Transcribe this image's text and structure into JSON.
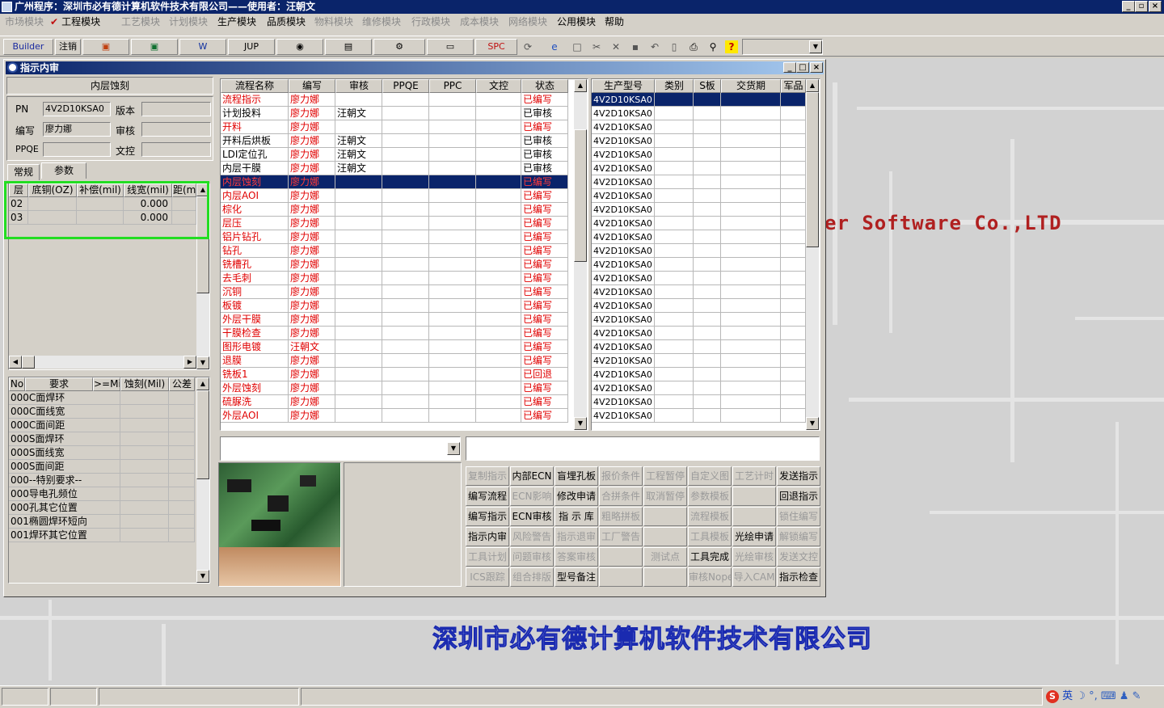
{
  "app": {
    "title": "广州程序：深圳市必有德计算机软件技术有限公司——使用者：汪朝文"
  },
  "menu": [
    {
      "label": "市场模块",
      "enabled": false
    },
    {
      "label": "工程模块",
      "enabled": true,
      "checked": true
    },
    {
      "label": "工艺模块",
      "enabled": false
    },
    {
      "label": "计划模块",
      "enabled": false
    },
    {
      "label": "生产模块",
      "enabled": true
    },
    {
      "label": "品质模块",
      "enabled": true
    },
    {
      "label": "物料模块",
      "enabled": false
    },
    {
      "label": "维修模块",
      "enabled": false
    },
    {
      "label": "行政模块",
      "enabled": false
    },
    {
      "label": "成本模块",
      "enabled": false
    },
    {
      "label": "网络模块",
      "enabled": false
    },
    {
      "label": "公用模块",
      "enabled": true
    },
    {
      "label": "帮助",
      "enabled": true
    }
  ],
  "toolbar": {
    "builder": "Builder",
    "logout": "注销",
    "jup": "JUP",
    "spc": "SPC"
  },
  "window": {
    "title": "指示内审"
  },
  "left_panel": {
    "process_title": "内层蚀刻",
    "pn_label": "PN",
    "pn_value": "4V2D10KSA0",
    "version_label": "版本",
    "version_value": "",
    "writer_label": "编写",
    "writer_value": "廖力娜",
    "review_label": "审核",
    "review_value": "",
    "ppqe_label": "PPQE",
    "ppqe_value": "",
    "doc_label": "文控",
    "doc_value": "",
    "tabs": [
      "常规",
      "参数"
    ],
    "param_headers": [
      "层",
      "底铜(OZ)",
      "补偿(mil)",
      "线宽(mil)",
      "距(mi"
    ],
    "param_rows": [
      [
        "02",
        "",
        "",
        "0.000",
        ""
      ],
      [
        "03",
        "",
        "",
        "0.000",
        ""
      ]
    ],
    "req_headers": [
      "No",
      "要求",
      ">=Mil",
      "蚀刻(Mil)",
      "公差"
    ],
    "req_rows": [
      [
        "000",
        "C面焊环"
      ],
      [
        "000",
        "C面线宽"
      ],
      [
        "000",
        "C面间距"
      ],
      [
        "000",
        "S面焊环"
      ],
      [
        "000",
        "S面线宽"
      ],
      [
        "000",
        "S面间距"
      ],
      [
        "000",
        "--特别要求--"
      ],
      [
        "000",
        "导电孔频位"
      ],
      [
        "000",
        "孔其它位置"
      ],
      [
        "001",
        "椭圆焊环短向"
      ],
      [
        "001",
        "焊环其它位置"
      ]
    ]
  },
  "process_grid": {
    "headers": [
      "流程名称",
      "编写",
      "审核",
      "PPQE",
      "PPC",
      "文控",
      "状态"
    ],
    "rows": [
      {
        "name": "流程指示",
        "writer": "廖力娜",
        "review": "",
        "status": "已编写",
        "red": true
      },
      {
        "name": "计划投料",
        "writer": "廖力娜",
        "review": "汪朝文",
        "status": "已审核",
        "red": false
      },
      {
        "name": "开料",
        "writer": "廖力娜",
        "review": "",
        "status": "已编写",
        "red": true
      },
      {
        "name": "开料后烘板",
        "writer": "廖力娜",
        "review": "汪朝文",
        "status": "已审核",
        "red": false
      },
      {
        "name": "LDI定位孔",
        "writer": "廖力娜",
        "review": "汪朝文",
        "status": "已审核",
        "red": false
      },
      {
        "name": "内层干膜",
        "writer": "廖力娜",
        "review": "汪朝文",
        "status": "已审核",
        "red": false
      },
      {
        "name": "内层蚀刻",
        "writer": "廖力娜",
        "review": "",
        "status": "已编写",
        "red": true,
        "selected": true
      },
      {
        "name": "内层AOI",
        "writer": "廖力娜",
        "review": "",
        "status": "已编写",
        "red": true
      },
      {
        "name": "棕化",
        "writer": "廖力娜",
        "review": "",
        "status": "已编写",
        "red": true
      },
      {
        "name": "层压",
        "writer": "廖力娜",
        "review": "",
        "status": "已编写",
        "red": true
      },
      {
        "name": "铝片钻孔",
        "writer": "廖力娜",
        "review": "",
        "status": "已编写",
        "red": true
      },
      {
        "name": "钻孔",
        "writer": "廖力娜",
        "review": "",
        "status": "已编写",
        "red": true
      },
      {
        "name": "铣槽孔",
        "writer": "廖力娜",
        "review": "",
        "status": "已编写",
        "red": true
      },
      {
        "name": "去毛刺",
        "writer": "廖力娜",
        "review": "",
        "status": "已编写",
        "red": true
      },
      {
        "name": "沉铜",
        "writer": "廖力娜",
        "review": "",
        "status": "已编写",
        "red": true
      },
      {
        "name": "板镀",
        "writer": "廖力娜",
        "review": "",
        "status": "已编写",
        "red": true
      },
      {
        "name": "外层干膜",
        "writer": "廖力娜",
        "review": "",
        "status": "已编写",
        "red": true
      },
      {
        "name": "干膜检查",
        "writer": "廖力娜",
        "review": "",
        "status": "已编写",
        "red": true
      },
      {
        "name": "图形电镀",
        "writer": "汪朝文",
        "review": "",
        "status": "已编写",
        "red": true
      },
      {
        "name": "退膜",
        "writer": "廖力娜",
        "review": "",
        "status": "已编写",
        "red": true
      },
      {
        "name": "铣板1",
        "writer": "廖力娜",
        "review": "",
        "status": "已回退",
        "red": true
      },
      {
        "name": "外层蚀刻",
        "writer": "廖力娜",
        "review": "",
        "status": "已编写",
        "red": true
      },
      {
        "name": "硫脲洗",
        "writer": "廖力娜",
        "review": "",
        "status": "已编写",
        "red": true
      },
      {
        "name": "外层AOI",
        "writer": "廖力娜",
        "review": "",
        "status": "已编写",
        "red": true
      }
    ]
  },
  "model_grid": {
    "headers": [
      "生产型号",
      "类别",
      "S板",
      "交货期",
      "军品"
    ],
    "rows": [
      "4V2D10KSA0",
      "4V2D10KSA0",
      "4V2D10KSA0",
      "4V2D10KSA0",
      "4V2D10KSA0",
      "4V2D10KSA0",
      "4V2D10KSA0",
      "4V2D10KSA0",
      "4V2D10KSA0",
      "4V2D10KSA0",
      "4V2D10KSA0",
      "4V2D10KSA0",
      "4V2D10KSA0",
      "4V2D10KSA0",
      "4V2D10KSA0",
      "4V2D10KSA0",
      "4V2D10KSA0",
      "4V2D10KSA0",
      "4V2D10KSA0",
      "4V2D10KSA0",
      "4V2D10KSA0",
      "4V2D10KSA0",
      "4V2D10KSA0",
      "4V2D10KSA0"
    ]
  },
  "buttons": [
    [
      {
        "label": "复制指示",
        "enabled": false
      },
      {
        "label": "内部ECN",
        "enabled": true
      },
      {
        "label": "盲埋孔板",
        "enabled": true
      },
      {
        "label": "报价条件",
        "enabled": false
      },
      {
        "label": "工程暂停",
        "enabled": false
      },
      {
        "label": "自定义图",
        "enabled": false
      },
      {
        "label": "工艺计时",
        "enabled": false
      },
      {
        "label": "发送指示",
        "enabled": true
      }
    ],
    [
      {
        "label": "编写流程",
        "enabled": true
      },
      {
        "label": "ECN影响",
        "enabled": false
      },
      {
        "label": "修改申请",
        "enabled": true
      },
      {
        "label": "合拼条件",
        "enabled": false
      },
      {
        "label": "取消暂停",
        "enabled": false
      },
      {
        "label": "参数模板",
        "enabled": false
      },
      {
        "label": "",
        "enabled": false
      },
      {
        "label": "回退指示",
        "enabled": true
      }
    ],
    [
      {
        "label": "编写指示",
        "enabled": true
      },
      {
        "label": "ECN审核",
        "enabled": true
      },
      {
        "label": "指 示 库",
        "enabled": true
      },
      {
        "label": "粗略拼板",
        "enabled": false
      },
      {
        "label": "",
        "enabled": false
      },
      {
        "label": "流程模板",
        "enabled": false
      },
      {
        "label": "",
        "enabled": false
      },
      {
        "label": "锁住编写",
        "enabled": false
      }
    ],
    [
      {
        "label": "指示内审",
        "enabled": true
      },
      {
        "label": "风险警告",
        "enabled": false
      },
      {
        "label": "指示退审",
        "enabled": false
      },
      {
        "label": "工厂警告",
        "enabled": false
      },
      {
        "label": "",
        "enabled": false
      },
      {
        "label": "工具模板",
        "enabled": false
      },
      {
        "label": "光绘申请",
        "enabled": true
      },
      {
        "label": "解锁编写",
        "enabled": false
      }
    ],
    [
      {
        "label": "工具计划",
        "enabled": false
      },
      {
        "label": "问题审核",
        "enabled": false
      },
      {
        "label": "答案审核",
        "enabled": false
      },
      {
        "label": "",
        "enabled": false
      },
      {
        "label": "测试点",
        "enabled": false
      },
      {
        "label": "工具完成",
        "enabled": true
      },
      {
        "label": "光绘审核",
        "enabled": false
      },
      {
        "label": "发送文控",
        "enabled": false
      }
    ],
    [
      {
        "label": "ICS跟踪",
        "enabled": false
      },
      {
        "label": "组合排版",
        "enabled": false
      },
      {
        "label": "型号备注",
        "enabled": true
      },
      {
        "label": "",
        "enabled": false
      },
      {
        "label": "",
        "enabled": false
      },
      {
        "label": "审核Nope",
        "enabled": false
      },
      {
        "label": "导入CAM",
        "enabled": false
      },
      {
        "label": "指示检查",
        "enabled": true
      }
    ]
  ],
  "background": {
    "company_en": "er Software Co.,LTD",
    "company_cn": "深圳市必有德计算机软件技术有限公司"
  },
  "tray": {
    "ime": "英"
  }
}
